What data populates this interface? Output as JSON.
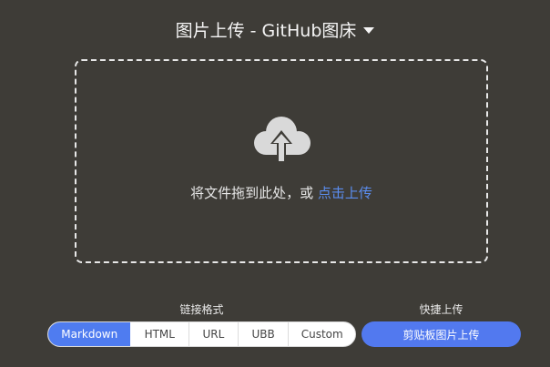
{
  "header": {
    "title": "图片上传 - GitHub图床"
  },
  "dropzone": {
    "text": "将文件拖到此处，或 ",
    "link": "点击上传",
    "icon": "cloud-upload-icon"
  },
  "link_format": {
    "label": "链接格式",
    "selected": "Markdown",
    "options": [
      "Markdown",
      "HTML",
      "URL",
      "UBB",
      "Custom"
    ]
  },
  "quick_upload": {
    "label": "快捷上传",
    "button": "剪贴板图片上传"
  },
  "colors": {
    "background": "#3e3c37",
    "accent": "#4f7cf0",
    "link": "#5b8def"
  }
}
